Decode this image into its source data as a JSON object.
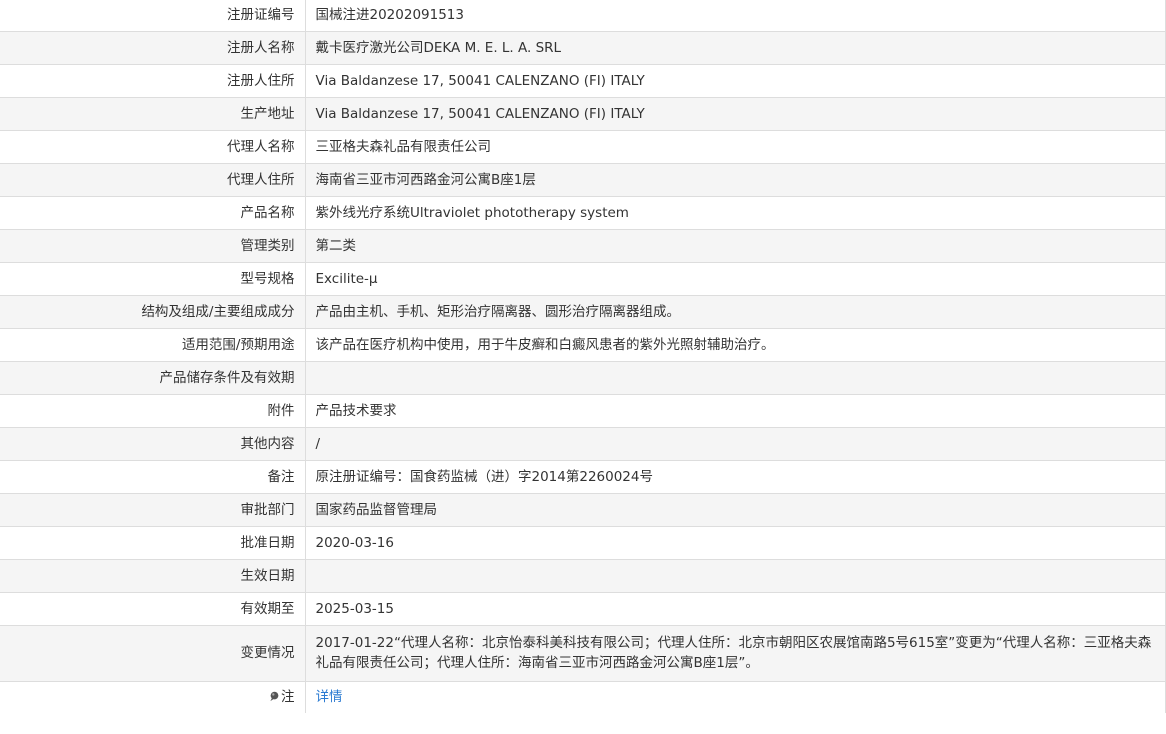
{
  "rows": [
    {
      "label": "注册证编号",
      "value": "国械注进20202091513"
    },
    {
      "label": "注册人名称",
      "value": "戴卡医疗激光公司DEKA M. E. L. A. SRL"
    },
    {
      "label": "注册人住所",
      "value": "Via Baldanzese 17, 50041 CALENZANO (FI) ITALY"
    },
    {
      "label": "生产地址",
      "value": "Via Baldanzese 17, 50041 CALENZANO (FI) ITALY"
    },
    {
      "label": "代理人名称",
      "value": "三亚格夫森礼品有限责任公司"
    },
    {
      "label": "代理人住所",
      "value": "海南省三亚市河西路金河公寓B座1层"
    },
    {
      "label": "产品名称",
      "value": "紫外线光疗系统Ultraviolet phototherapy system"
    },
    {
      "label": "管理类别",
      "value": "第二类"
    },
    {
      "label": "型号规格",
      "value": "Excilite-μ"
    },
    {
      "label": "结构及组成/主要组成成分",
      "value": "产品由主机、手机、矩形治疗隔离器、圆形治疗隔离器组成。"
    },
    {
      "label": "适用范围/预期用途",
      "value": "该产品在医疗机构中使用，用于牛皮癣和白癜风患者的紫外光照射辅助治疗。"
    },
    {
      "label": "产品储存条件及有效期",
      "value": ""
    },
    {
      "label": "附件",
      "value": "产品技术要求"
    },
    {
      "label": "其他内容",
      "value": "/"
    },
    {
      "label": "备注",
      "value": "原注册证编号：国食药监械（进）字2014第2260024号"
    },
    {
      "label": "审批部门",
      "value": "国家药品监督管理局"
    },
    {
      "label": "批准日期",
      "value": "2020-03-16"
    },
    {
      "label": "生效日期",
      "value": ""
    },
    {
      "label": "有效期至",
      "value": "2025-03-15"
    },
    {
      "label": "变更情况",
      "value": "2017-01-22“代理人名称：北京怡泰科美科技有限公司；代理人住所：北京市朝阳区农展馆南路5号615室”变更为“代理人名称：三亚格夫森礼品有限责任公司；代理人住所：海南省三亚市河西路金河公寓B座1层”。"
    }
  ],
  "note": {
    "label": "注",
    "link": "详情",
    "icon": "pin-icon"
  },
  "colors": {
    "border": "#dddddd",
    "alt_row": "#f5f5f5",
    "link": "#2a7ad2",
    "text": "#333333"
  }
}
